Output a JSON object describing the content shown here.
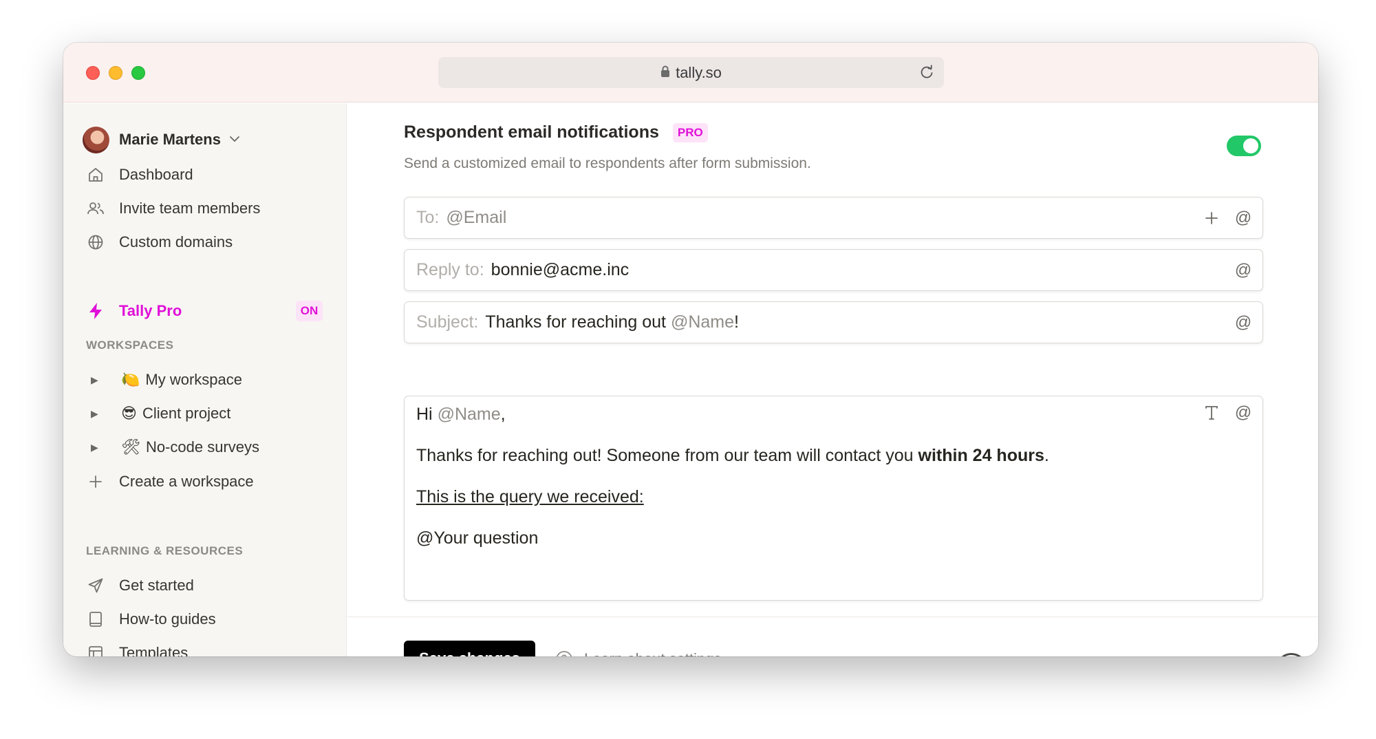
{
  "browser": {
    "url": "tally.so"
  },
  "sidebar": {
    "user_name": "Marie Martens",
    "nav": [
      {
        "label": "Dashboard",
        "icon": "home-icon"
      },
      {
        "label": "Invite team members",
        "icon": "users-icon"
      },
      {
        "label": "Custom domains",
        "icon": "globe-icon"
      },
      {
        "label": "Tally Pro",
        "icon": "lightning-icon",
        "badge": "ON"
      }
    ],
    "workspaces_title": "WORKSPACES",
    "workspaces": [
      {
        "emoji": "🍋",
        "label": "My workspace"
      },
      {
        "emoji": "😎",
        "label": "Client project"
      },
      {
        "emoji": "🛠",
        "label": "No-code surveys"
      }
    ],
    "create_workspace": "Create a workspace",
    "resources_title": "LEARNING & RESOURCES",
    "resources": [
      {
        "label": "Get started",
        "icon": "send-icon"
      },
      {
        "label": "How-to guides",
        "icon": "book-icon"
      },
      {
        "label": "Templates",
        "icon": "template-icon"
      }
    ]
  },
  "settings": {
    "title": "Respondent email notifications",
    "pro_badge": "PRO",
    "description": "Send a customized email to respondents after form submission.",
    "enabled": true,
    "to": {
      "label": "To:",
      "value": "@Email"
    },
    "reply_to": {
      "label": "Reply to:",
      "value": "bonnie@acme.inc"
    },
    "subject": {
      "label": "Subject:",
      "text": "Thanks for reaching out ",
      "mention": "@Name",
      "suffix": "!"
    },
    "body": {
      "greeting": "Hi ",
      "greeting_mention": "@Name",
      "greeting_suffix": ",",
      "line1": "Thanks for reaching out! Someone from our team will contact you ",
      "line1_bold": "within 24 hours",
      "line1_suffix": ".",
      "line2": "This is the query we received:",
      "line3_mention": "@Your question"
    }
  },
  "footer": {
    "save_label": "Save changes",
    "learn_label": "Learn about settings",
    "help_label": "?"
  },
  "colors": {
    "accent_pink": "#e010d8",
    "toggle_green": "#22c768",
    "titlebar": "#fbf1ef"
  }
}
